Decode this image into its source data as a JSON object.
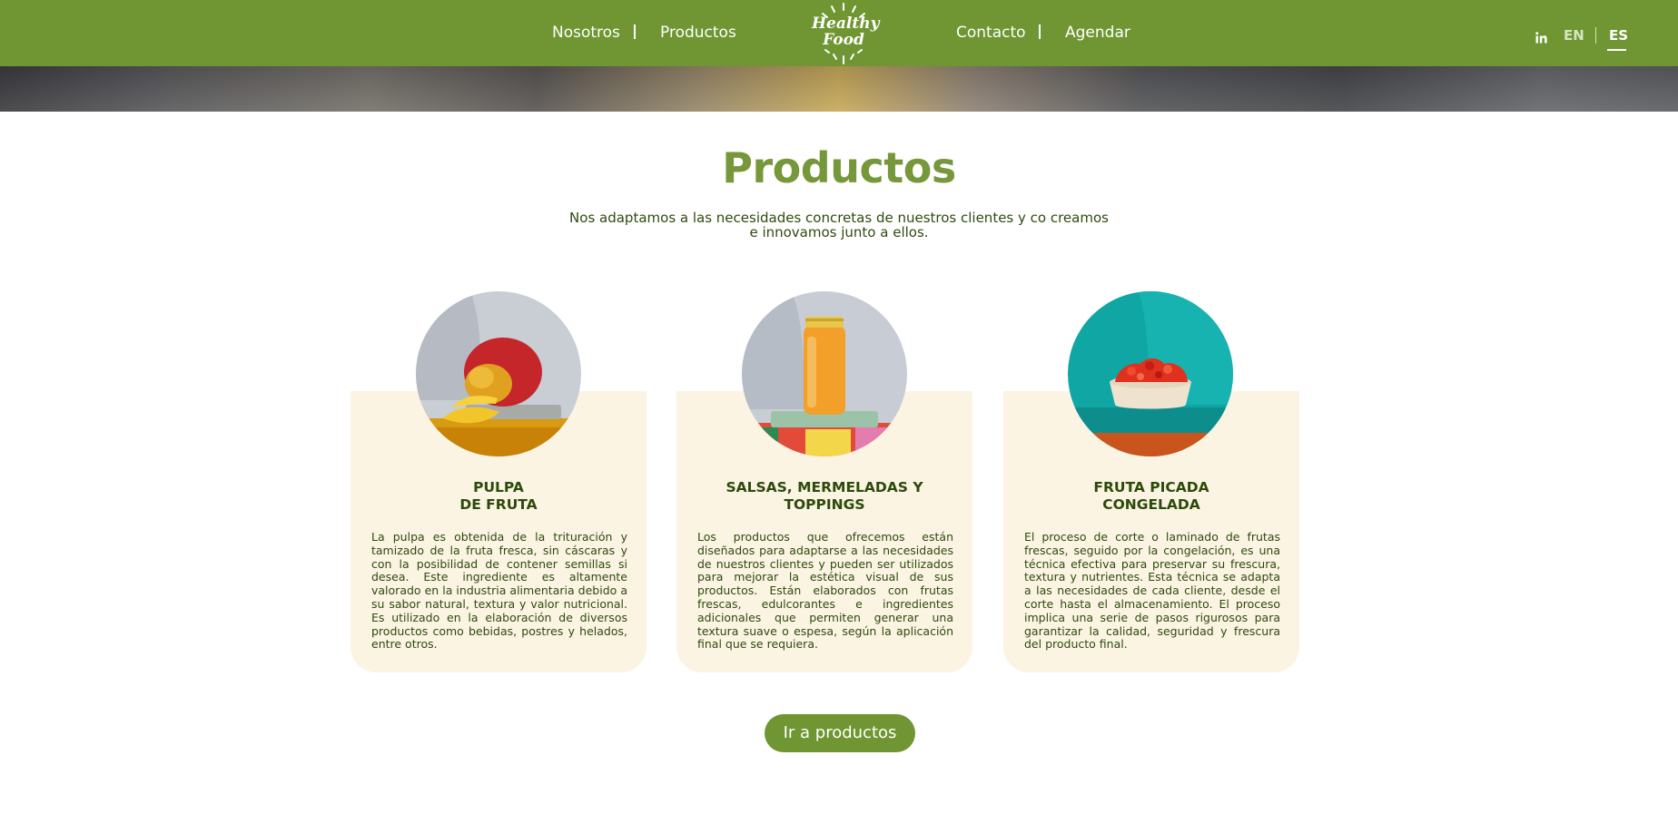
{
  "nav": {
    "links": [
      "Nosotros",
      "Productos",
      "Contacto",
      "Agendar"
    ],
    "logo": {
      "line1": "Healthy",
      "line2": "Food"
    },
    "social_icon": "linkedin-icon",
    "social_label": "in",
    "languages": [
      "EN",
      "ES"
    ],
    "active_language": "ES"
  },
  "colors": {
    "brand_green": "#6f9632",
    "title_green": "#76973a",
    "card_background": "#fbf4e2",
    "text_dark_green": "#2e4a0f"
  },
  "section": {
    "title": "Productos",
    "subtitle_line1": "Nos adaptamos a las necesidades concretas de nuestros clientes y co creamos",
    "subtitle_line2": "e innovamos junto a ellos."
  },
  "cards": [
    {
      "title": "PULPA\nDE FRUTA",
      "text": "La pulpa es obtenida de la trituración y tamizado de la fruta fresca, sin cáscaras y con la posibilidad de contener semillas si desea. Este ingrediente es altamente valorado en la industria alimentaria debido a su sabor natural, textura y valor nutricional. Es utilizado en la elaboración de diversos productos como bebidas, postres y helados, entre otros.",
      "image": "mango-photo"
    },
    {
      "title": "SALSAS, MERMELADAS Y\nTOPPINGS",
      "text": "Los productos que ofrecemos están diseñados para adaptarse a las necesidades de nuestros clientes y pueden ser utilizados para mejorar la estética visual de sus productos. Están elaborados con frutas frescas, edulcorantes e ingredientes adicionales que permiten generar una textura suave o espesa, según la aplicación final que se requiera.",
      "image": "jam-jar-photo"
    },
    {
      "title": "FRUTA PICADA\nCONGELADA",
      "text": "El proceso de corte o laminado de frutas frescas, seguido por la congelación, es una técnica efectiva para preservar su frescura, textura y nutrientes. Esta técnica se adapta a las necesidades de cada cliente, desde el corte hasta el almacenamiento. El proceso implica una serie de pasos rigurosos para garantizar la calidad, seguridad y frescura del producto final.",
      "image": "chopped-fruit-bowl-photo"
    }
  ],
  "cta": {
    "label": "Ir a productos"
  }
}
